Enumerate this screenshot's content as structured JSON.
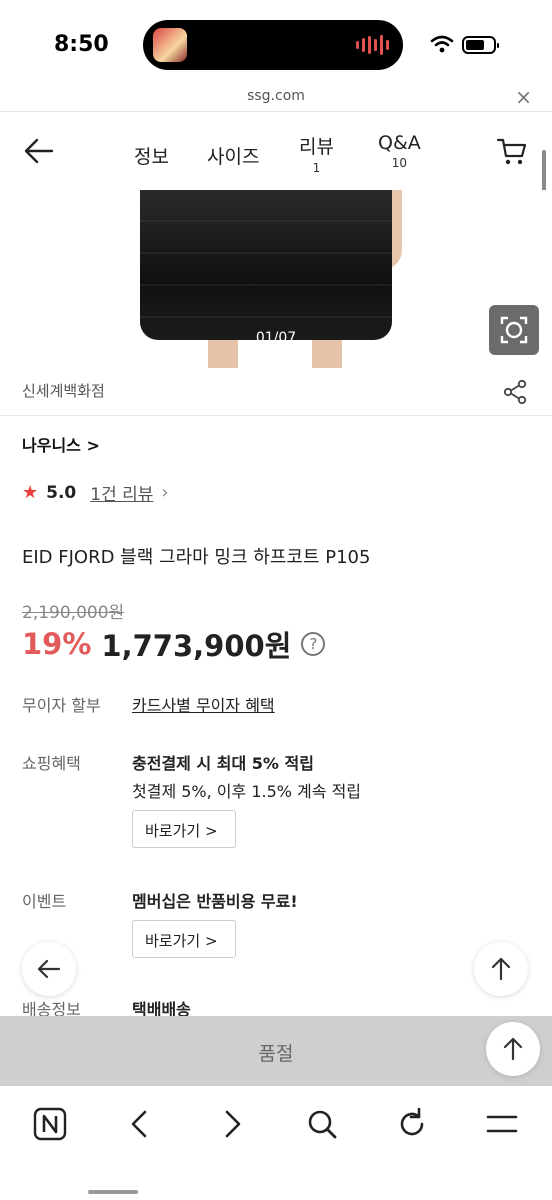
{
  "status_bar": {
    "time": "8:50"
  },
  "browser": {
    "url": "ssg.com"
  },
  "nav": {
    "tabs": [
      {
        "label": "정보",
        "count": ""
      },
      {
        "label": "사이즈",
        "count": ""
      },
      {
        "label": "리뷰",
        "count": "1"
      },
      {
        "label": "Q&A",
        "count": "10"
      }
    ]
  },
  "gallery": {
    "counter": "01/07"
  },
  "store": {
    "name": "신세계백화점"
  },
  "product": {
    "brand": "나우니스 >",
    "rating": "5.0",
    "review_link": "1건 리뷰",
    "title": "EID FJORD 블랙 그라마 밍크 하프코트 P105",
    "original_price": "2,190,000원",
    "discount": "19%",
    "price": "1,773,900원"
  },
  "info": {
    "installment_label": "무이자 할부",
    "installment_value": "카드사별 무이자 혜택",
    "benefit_label": "쇼핑혜택",
    "benefit_title": "충전결제 시 최대 5% 적립",
    "benefit_desc": "첫결제 5%, 이후 1.5% 계속 적립",
    "goto_label": "바로가기 >",
    "event_label": "이벤트",
    "event_title": "멤버십은 반품비용 무료!",
    "shipping_label": "배송정보",
    "shipping_value": "택배배송"
  },
  "bottom": {
    "soldout_label": "품절"
  },
  "colors": {
    "accent": "#e35a5a",
    "star": "#e8403c"
  },
  "icons": [
    "back-arrow-icon",
    "cart-icon",
    "lens-icon",
    "share-icon",
    "star-icon",
    "help-icon",
    "up-arrow-icon",
    "naver-icon",
    "chevron-left-icon",
    "chevron-right-icon",
    "search-icon",
    "refresh-icon",
    "menu-icon"
  ]
}
